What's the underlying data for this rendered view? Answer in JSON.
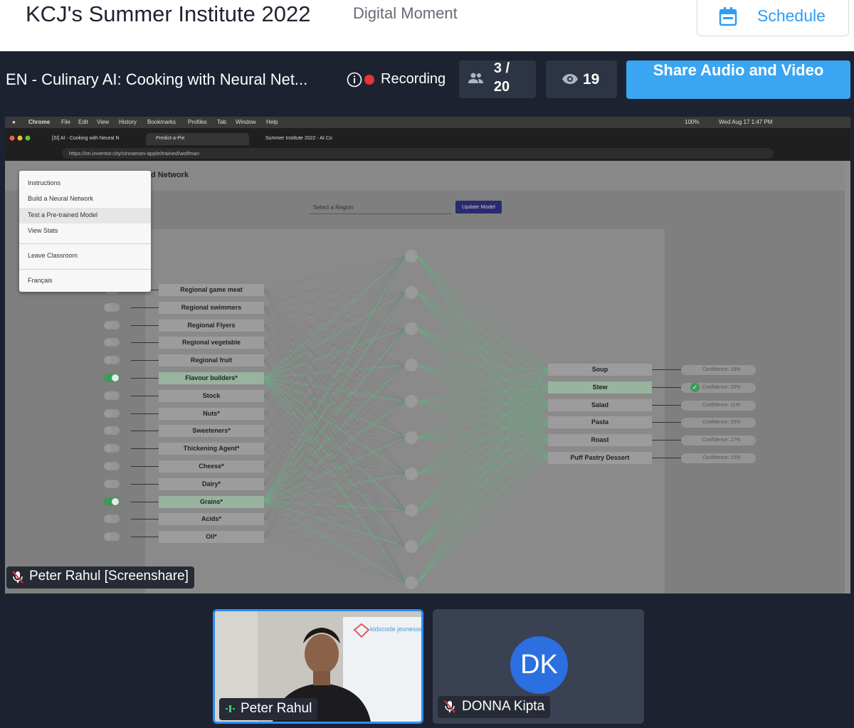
{
  "header": {
    "event_title": "KCJ's Summer Institute 2022",
    "event_subtitle": "Digital Moment",
    "schedule_label": "Schedule"
  },
  "session": {
    "title": "EN - Culinary AI: Cooking with Neural Net...",
    "recording_label": "Recording",
    "participants": "3 / 20",
    "viewers": "19",
    "share_label": "Share Audio and Video"
  },
  "screenshare": {
    "mac_menu": [
      "Chrome",
      "File",
      "Edit",
      "View",
      "History",
      "Bookmarks",
      "Profiles",
      "Tab",
      "Window",
      "Help"
    ],
    "mac_clock": "Wed Aug 17  1:47 PM",
    "battery": "100%",
    "tabs": [
      "[SI] AI - Cooking with Neural N",
      "Predict-a-Pie",
      "Summer Institute 2022 - AI Co"
    ],
    "url": "https://nn.inventor.city/cinnamon-apple/trained/wolfman",
    "page_title": "d Network",
    "select_placeholder": "Select a Region",
    "update_button": "Update Model",
    "menu": {
      "items": [
        "Instructions",
        "Build a Neural Network",
        "Test a Pre-trained Model",
        "View Stats"
      ],
      "leave": "Leave Classroom",
      "language": "Français"
    },
    "inputs": [
      {
        "label": "Regional game meat",
        "on": false
      },
      {
        "label": "Regional swimmers",
        "on": false
      },
      {
        "label": "Regional Flyers",
        "on": false
      },
      {
        "label": "Regional vegetable",
        "on": false
      },
      {
        "label": "Regional fruit",
        "on": false
      },
      {
        "label": "Flavour builders*",
        "on": true
      },
      {
        "label": "Stock",
        "on": false
      },
      {
        "label": "Nuts*",
        "on": false
      },
      {
        "label": "Sweeteners*",
        "on": false
      },
      {
        "label": "Thickening Agent*",
        "on": false
      },
      {
        "label": "Cheese*",
        "on": false
      },
      {
        "label": "Dairy*",
        "on": false
      },
      {
        "label": "Grains*",
        "on": true
      },
      {
        "label": "Acids*",
        "on": false
      },
      {
        "label": "Oil*",
        "on": false
      }
    ],
    "outputs": [
      {
        "label": "Soup",
        "confidence": "Confidence: 18%",
        "selected": false
      },
      {
        "label": "Stew",
        "confidence": "Confidence: 25%",
        "selected": true
      },
      {
        "label": "Salad",
        "confidence": "Confidence: 11%",
        "selected": false
      },
      {
        "label": "Pasta",
        "confidence": "Confidence: 16%",
        "selected": false
      },
      {
        "label": "Roast",
        "confidence": "Confidence: 17%",
        "selected": false
      },
      {
        "label": "Puff Pastry Dessert",
        "confidence": "Confidence: 15%",
        "selected": false
      }
    ],
    "presenter_label": "Peter Rahul [Screenshare]"
  },
  "participants": [
    {
      "name": "Peter Rahul",
      "speaking": true,
      "banner_text": "kidscode jeunesse"
    },
    {
      "name": "DONNA Kipta",
      "initials": "DK",
      "muted": true
    }
  ],
  "colors": {
    "accent": "#3aa5f2",
    "record": "#e5343a",
    "avatar": "#2b6fe0",
    "active_node": "#3f9a55"
  }
}
